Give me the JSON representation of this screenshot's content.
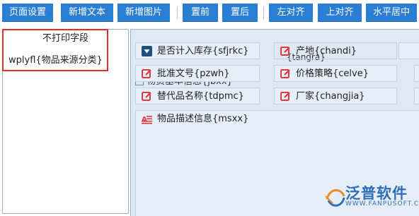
{
  "toolbar": {
    "buttons": [
      "页面设置",
      "新增文本",
      "新增图片",
      "置前",
      "置后",
      "左对齐",
      "上对齐",
      "水平居中"
    ]
  },
  "left_panel": {
    "header": "不打印字段",
    "rows": [
      "wplyfl{物品来源分类}"
    ]
  },
  "canvas": {
    "items": [
      "是否计入库存{sfjrkc}",
      "产地{chandi}",
      "批准文号{pzwh}",
      "价格策略{celve}",
      "替代品名称{tdpmc}",
      "厂家{changjia}",
      "物品描述信息{msxx}"
    ],
    "overlaps": {
      "tangra": "{tangra}",
      "wzjbxx": "物资基本信息{jbxx}"
    }
  },
  "logo": {
    "name": "泛普软件",
    "url": "WWW.FANPUSOFT.COM"
  },
  "colors": {
    "button_bg": "#2a7fd4",
    "highlight_border": "#e02c2c",
    "canvas_bg": "#dfe9f4",
    "edit_icon": "#e0383d",
    "dropdown_icon": "#1f4f7a"
  }
}
